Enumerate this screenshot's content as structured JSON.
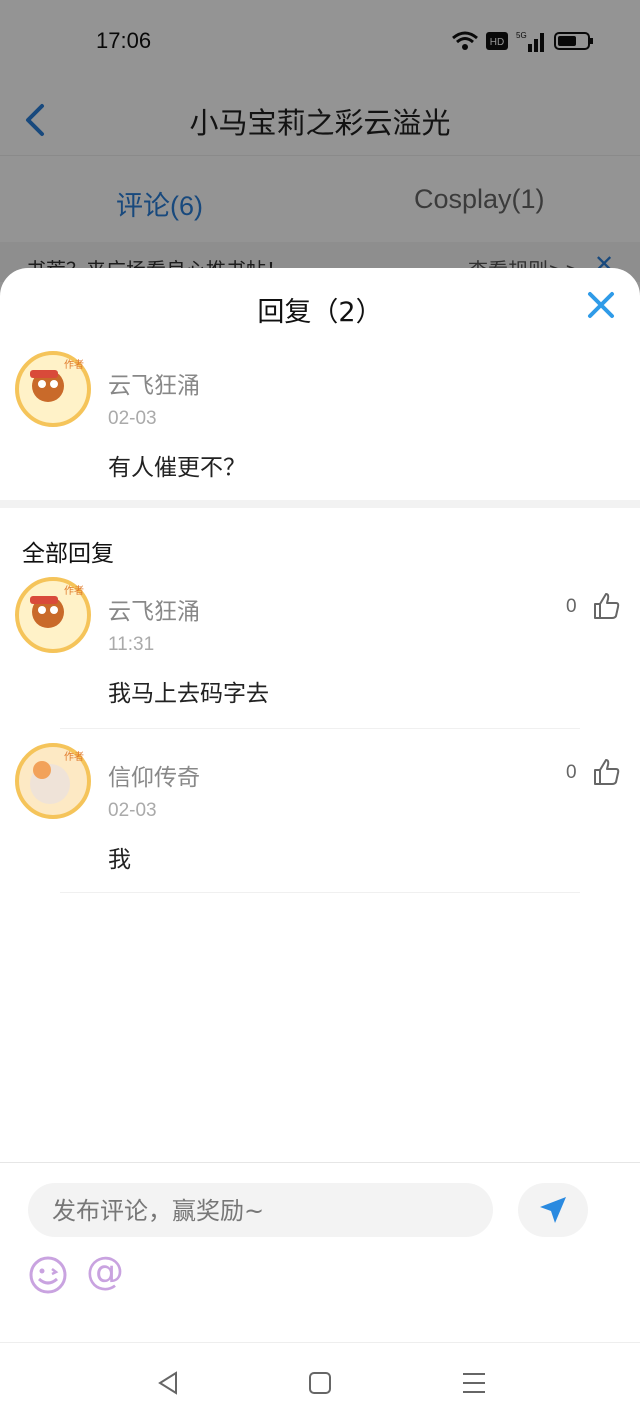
{
  "status_bar": {
    "time": "17:06",
    "icons": [
      "wifi-icon",
      "hd-icon",
      "signal-5g-icon",
      "battery-icon"
    ]
  },
  "nav": {
    "title": "小马宝莉之彩云溢光",
    "back_icon": "chevron-left-icon"
  },
  "tabs": [
    {
      "label": "评论(6)",
      "active": true
    },
    {
      "label": "Cosplay(1)",
      "active": false
    }
  ],
  "promo": {
    "text": "书荒？来广场看良心推书帖！",
    "rules": "查看规则>>",
    "close": "✕"
  },
  "sheet": {
    "title": "回复（2）",
    "original": {
      "user": "云飞狂涌",
      "date": "02-03",
      "content": "有人催更不？",
      "avatar_badge": "作者"
    },
    "section_title": "全部回复",
    "replies": [
      {
        "user": "云飞狂涌",
        "time": "11:31",
        "content": "我马上去码字去",
        "likes": "0",
        "avatar_badge": "作者"
      },
      {
        "user": "信仰传奇",
        "time": "02-03",
        "content": "我",
        "likes": "0",
        "avatar_badge": "作者"
      }
    ]
  },
  "composer": {
    "placeholder": "发布评论，赢奖励~",
    "at": "@"
  },
  "colors": {
    "accent": "#2a7ed8",
    "close": "#2f9be8",
    "send": "#2a8ae0"
  }
}
